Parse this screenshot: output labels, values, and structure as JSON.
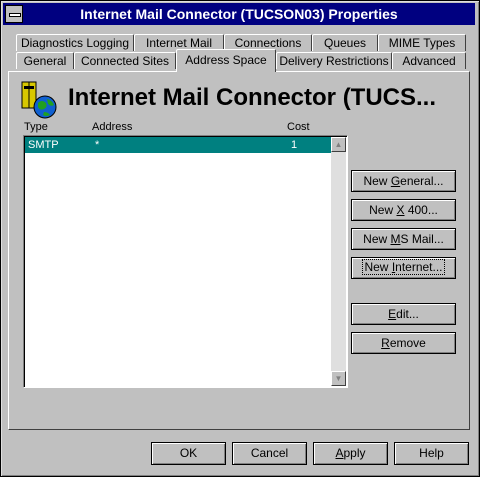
{
  "window": {
    "title": "Internet Mail Connector (TUCSON03) Properties"
  },
  "tabs_row_top": [
    {
      "label": "Diagnostics Logging"
    },
    {
      "label": "Internet Mail"
    },
    {
      "label": "Connections"
    },
    {
      "label": "Queues"
    },
    {
      "label": "MIME Types"
    }
  ],
  "tabs_row_bottom": [
    {
      "label": "General"
    },
    {
      "label": "Connected Sites"
    },
    {
      "label": "Address Space",
      "active": true
    },
    {
      "label": "Delivery Restrictions"
    },
    {
      "label": "Advanced"
    }
  ],
  "panel": {
    "heading": "Internet Mail Connector (TUCS...",
    "columns": [
      "Type",
      "Address",
      "Cost"
    ],
    "rows": [
      {
        "type": "SMTP",
        "address": "*",
        "cost": "1",
        "selected": true
      }
    ]
  },
  "side_buttons": {
    "new_general": {
      "pre": "New ",
      "key": "G",
      "post": "eneral..."
    },
    "new_x400": {
      "pre": "New ",
      "key": "X",
      "post": " 400..."
    },
    "new_msmail": {
      "pre": "New ",
      "key": "M",
      "post": "S Mail..."
    },
    "new_internet": {
      "pre": "New ",
      "key": "I",
      "post": "nternet..."
    },
    "edit": {
      "pre": "",
      "key": "E",
      "post": "dit..."
    },
    "remove": {
      "pre": "",
      "key": "R",
      "post": "emove"
    }
  },
  "footer_buttons": {
    "ok": {
      "label": "OK"
    },
    "cancel": {
      "label": "Cancel"
    },
    "apply": {
      "pre": "",
      "key": "A",
      "post": "pply"
    },
    "help": {
      "label": "Help"
    }
  },
  "colors": {
    "title_bar": "#000080",
    "selection": "#008080",
    "face": "#c0c0c0"
  }
}
